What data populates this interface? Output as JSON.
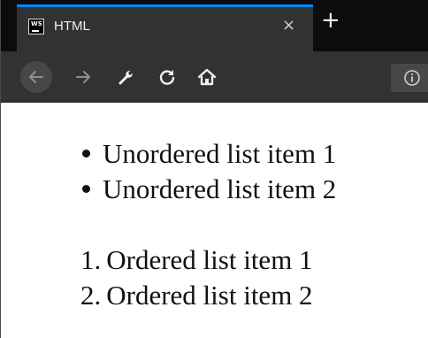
{
  "browser": {
    "tab": {
      "favicon_text": "WS",
      "title": "HTML",
      "close_glyph": "×"
    },
    "new_tab_glyph": "+",
    "nav": {
      "back_icon": "arrow-left-icon",
      "forward_icon": "arrow-right-icon",
      "tools_icon": "wrench-icon",
      "reload_icon": "reload-icon",
      "home_icon": "home-icon",
      "info_icon": "info-icon"
    },
    "colors": {
      "tab_accent": "#0a84ff",
      "tabstrip_bg": "#0c0c0d",
      "toolbar_bg": "#323234"
    }
  },
  "page": {
    "unordered_list": [
      "Unordered list item 1",
      "Unordered list item 2"
    ],
    "ordered_list": [
      {
        "marker": "1.",
        "text": "Ordered list item 1"
      },
      {
        "marker": "2.",
        "text": "Ordered list item 2"
      }
    ]
  }
}
